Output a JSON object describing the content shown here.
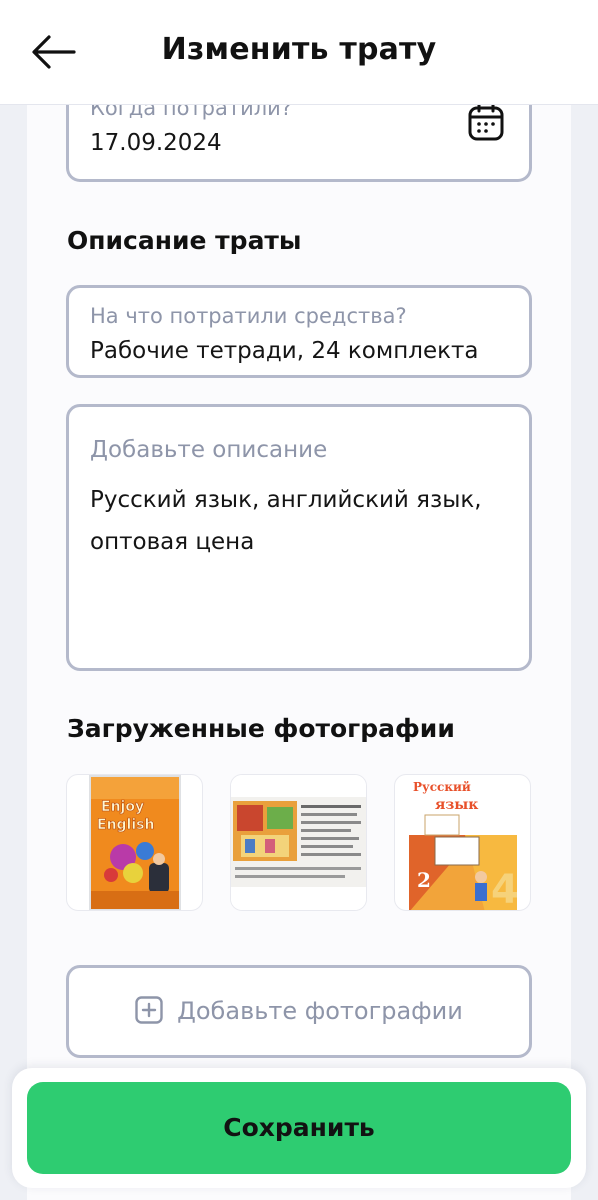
{
  "header": {
    "title": "Изменить трату",
    "back_icon": "arrow-left-icon"
  },
  "date_field": {
    "label": "Когда потратили?",
    "value": "17.09.2024",
    "icon": "calendar-icon"
  },
  "description_section": {
    "title": "Описание траты",
    "spend_field": {
      "label": "На что потратили средства?",
      "value": "Рабочие тетради, 24 комплекта"
    },
    "desc_field": {
      "label": "Добавьте описание",
      "value": "Русский язык, английский язык, оптовая цена"
    }
  },
  "photos_section": {
    "title": "Загруженные фотографии",
    "photos": [
      {
        "name": "photo-enjoy-english",
        "cover_text": "Enjoy English"
      },
      {
        "name": "photo-workbook-pages"
      },
      {
        "name": "photo-russkiy-yazyk",
        "cover_text": "Русский язык"
      }
    ],
    "add_button": {
      "label": "Добавьте фотографии",
      "icon": "plus-square-icon"
    }
  },
  "footer": {
    "save_label": "Сохранить"
  },
  "colors": {
    "accent_green": "#2ecc71",
    "border_gray": "#b4b9cb",
    "label_gray": "#8e95a9",
    "background": "#eef0f5"
  }
}
